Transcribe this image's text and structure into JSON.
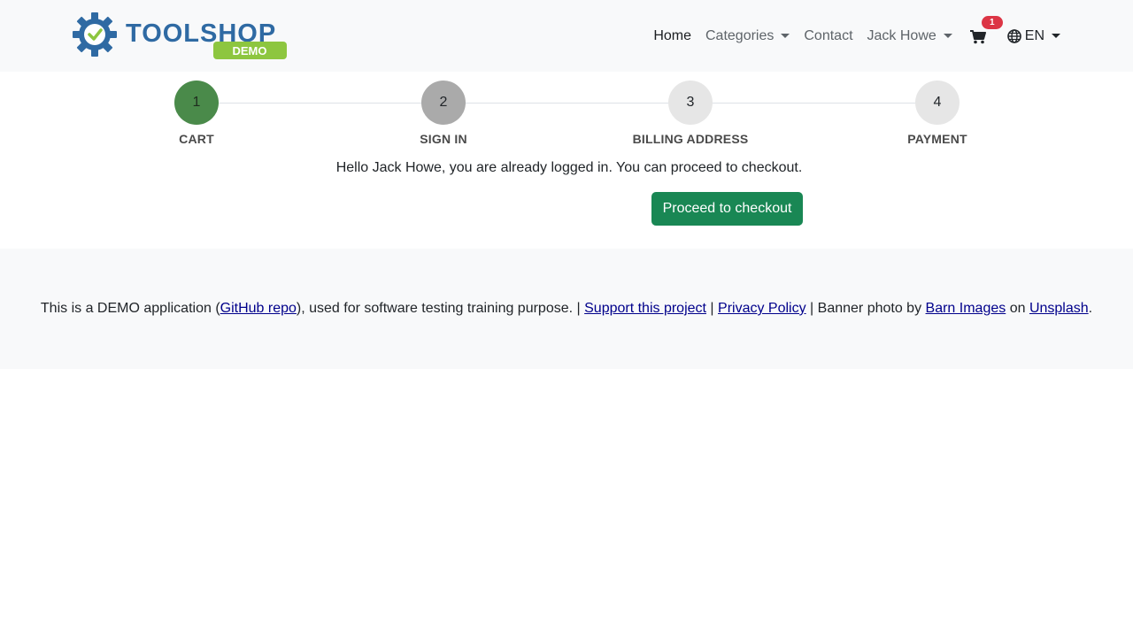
{
  "logo": {
    "name": "TOOLSHOP",
    "badge": "DEMO"
  },
  "nav": {
    "home": "Home",
    "categories": "Categories",
    "contact": "Contact",
    "user": "Jack Howe",
    "cart_count": "1",
    "language": "EN"
  },
  "steps": [
    {
      "number": "1",
      "label": "CART"
    },
    {
      "number": "2",
      "label": "SIGN IN"
    },
    {
      "number": "3",
      "label": "BILLING ADDRESS"
    },
    {
      "number": "4",
      "label": "PAYMENT"
    }
  ],
  "message": "Hello Jack Howe, you are already logged in. You can proceed to checkout.",
  "checkout_button": "Proceed to checkout",
  "footer": {
    "text1": "This is a DEMO application (",
    "github": "GitHub repo",
    "text2": "), used for software testing training purpose. | ",
    "support": "Support this project",
    "sep1": " | ",
    "privacy": "Privacy Policy",
    "text3": " | Banner photo by ",
    "barn": "Barn Images",
    "text4": " on ",
    "unsplash": "Unsplash",
    "text5": "."
  },
  "colors": {
    "accent": "#198754",
    "badge": "#dc3545",
    "step_done": "#4a8a4a",
    "step_current": "#aaaaaa",
    "step_pending": "#e6e6e6"
  }
}
